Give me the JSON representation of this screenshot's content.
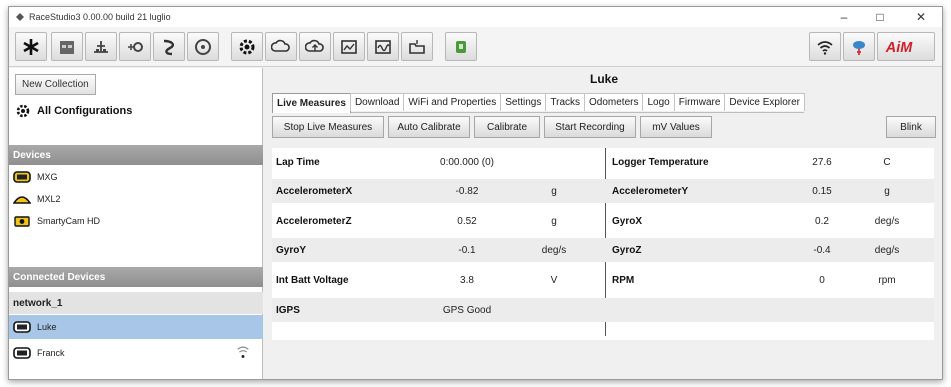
{
  "window": {
    "title": "RaceStudio3 0.00.00 build 21 luglio",
    "minimize": "–",
    "maximize": "□",
    "close": "✕"
  },
  "toolbar": {
    "left_icons": [
      "asterisk-icon",
      "calendar-icon",
      "balance-icon",
      "settings-plus-icon",
      "track-icon",
      "gauge-icon"
    ],
    "mid_icons": [
      "gear-wheel-icon",
      "cloud-download-icon",
      "cloud-upload-icon",
      "chart-icon",
      "chart-wave-icon",
      "folder-icon",
      "usb-icon"
    ],
    "right_icons": [
      "wifi-icon",
      "usb-device-icon"
    ],
    "brand": "AiM"
  },
  "sidebar": {
    "new_collection": "New Collection",
    "all_configurations": "All Configurations",
    "devices_header": "Devices",
    "devices": [
      {
        "label": "MXG",
        "icon": "dash-logger-icon"
      },
      {
        "label": "MXL2",
        "icon": "dash-logger-icon"
      },
      {
        "label": "SmartyCam HD",
        "icon": "camera-icon"
      }
    ],
    "connected_header": "Connected Devices",
    "network": "network_1",
    "connected": [
      {
        "label": "Luke",
        "selected": true
      },
      {
        "label": "Franck",
        "selected": false
      }
    ]
  },
  "main": {
    "device_title": "Luke",
    "tabs": [
      "Live Measures",
      "Download",
      "WiFi and Properties",
      "Settings",
      "Tracks",
      "Odometers",
      "Logo",
      "Firmware",
      "Device Explorer"
    ],
    "active_tab": "Live Measures",
    "actions": [
      "Stop Live Measures",
      "Auto Calibrate",
      "Calibrate",
      "Start Recording",
      "mV Values"
    ],
    "blink": "Blink",
    "measures": [
      {
        "left": {
          "name": "Lap Time",
          "value": "0:00.000 (0)",
          "unit": ""
        },
        "right": {
          "name": "Logger Temperature",
          "value": "27.6",
          "unit": "C"
        }
      },
      {
        "left": {
          "name": "AccelerometerX",
          "value": "-0.82",
          "unit": "g"
        },
        "right": {
          "name": "AccelerometerY",
          "value": "0.15",
          "unit": "g"
        }
      },
      {
        "left": {
          "name": "AccelerometerZ",
          "value": "0.52",
          "unit": "g"
        },
        "right": {
          "name": "GyroX",
          "value": "0.2",
          "unit": "deg/s"
        }
      },
      {
        "left": {
          "name": "GyroY",
          "value": "-0.1",
          "unit": "deg/s"
        },
        "right": {
          "name": "GyroZ",
          "value": "-0.4",
          "unit": "deg/s"
        }
      },
      {
        "left": {
          "name": "Int Batt Voltage",
          "value": "3.8",
          "unit": "V"
        },
        "right": {
          "name": "RPM",
          "value": "0",
          "unit": "rpm"
        }
      },
      {
        "left": {
          "name": "IGPS",
          "value": "GPS Good",
          "unit": ""
        },
        "right": {
          "name": "",
          "value": "",
          "unit": ""
        }
      }
    ]
  },
  "colors": {
    "selection": "#a8c7e8",
    "section_header": "#9b9b9b",
    "brand_red": "#d0202a"
  }
}
